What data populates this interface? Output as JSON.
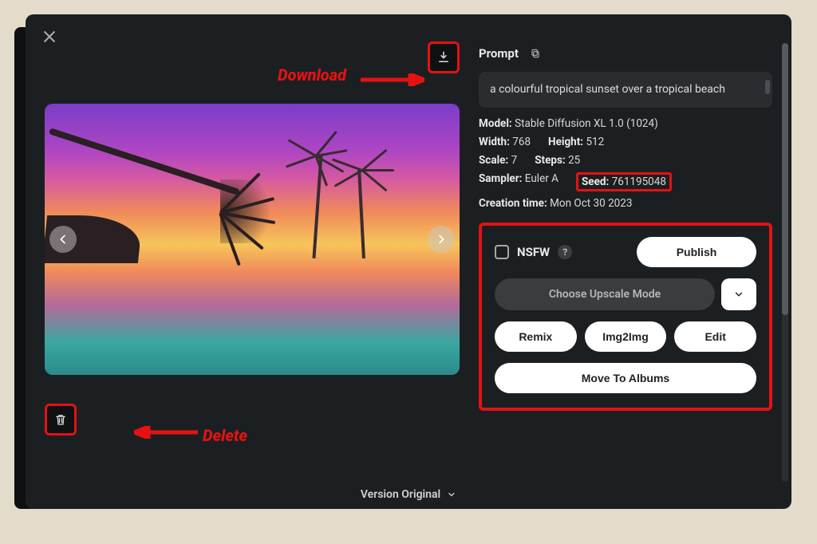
{
  "annotations": {
    "download_label": "Download",
    "delete_label": "Delete"
  },
  "prompt": {
    "label": "Prompt",
    "text": "a colourful tropical sunset over a tropical beach"
  },
  "meta": {
    "model_label": "Model:",
    "model": "Stable Diffusion XL 1.0 (1024)",
    "width_label": "Width:",
    "width": "768",
    "height_label": "Height:",
    "height": "512",
    "scale_label": "Scale:",
    "scale": "7",
    "steps_label": "Steps:",
    "steps": "25",
    "sampler_label": "Sampler:",
    "sampler": "Euler A",
    "seed_label": "Seed:",
    "seed": "761195048",
    "ctime_label": "Creation time:",
    "ctime": "Mon Oct 30 2023"
  },
  "actions": {
    "nsfw_label": "NSFW",
    "publish": "Publish",
    "upscale": "Choose Upscale Mode",
    "remix": "Remix",
    "img2img": "Img2Img",
    "edit": "Edit",
    "move": "Move To Albums"
  },
  "footer": {
    "version": "Version Original"
  }
}
